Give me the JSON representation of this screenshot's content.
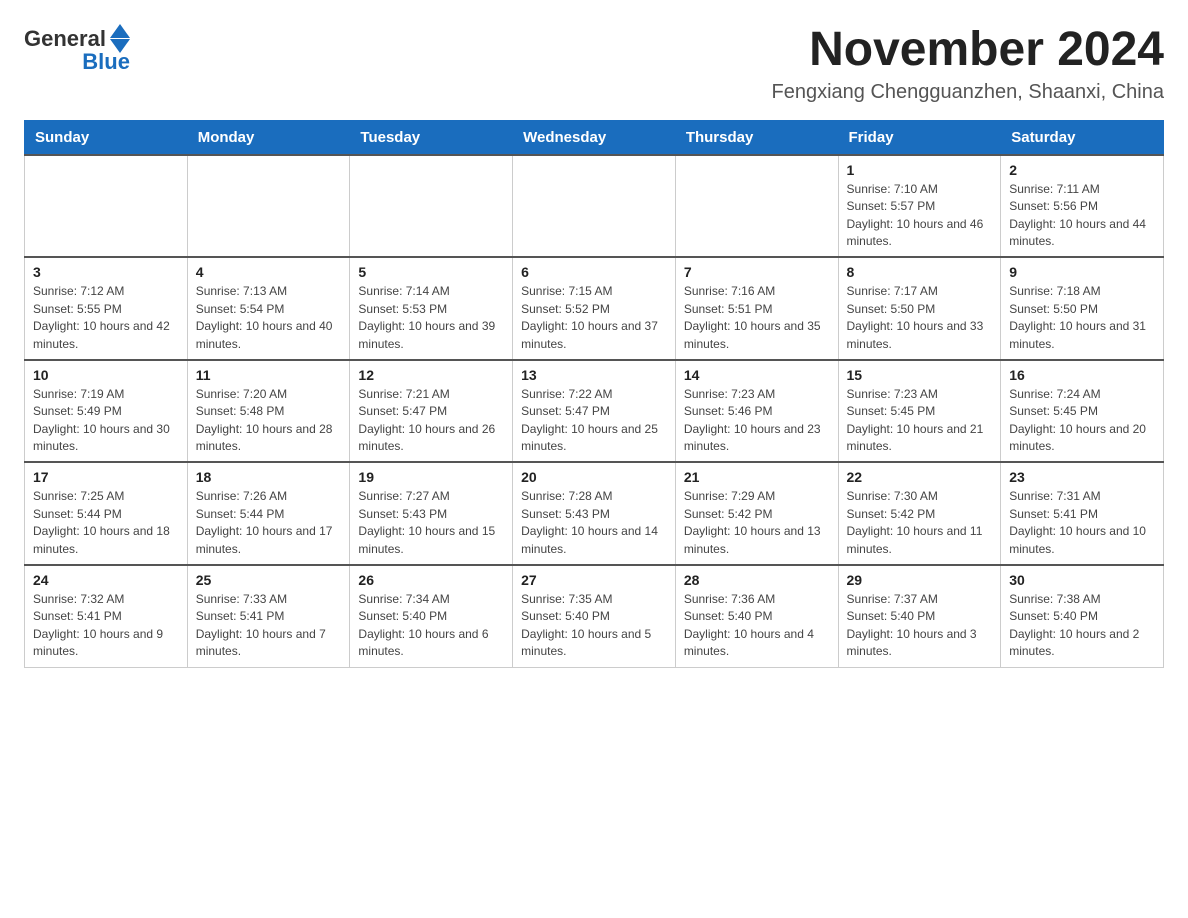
{
  "header": {
    "logo_general": "General",
    "logo_blue": "Blue",
    "title": "November 2024",
    "location": "Fengxiang Chengguanzhen, Shaanxi, China"
  },
  "days_of_week": [
    "Sunday",
    "Monday",
    "Tuesday",
    "Wednesday",
    "Thursday",
    "Friday",
    "Saturday"
  ],
  "weeks": [
    [
      {
        "day": "",
        "info": ""
      },
      {
        "day": "",
        "info": ""
      },
      {
        "day": "",
        "info": ""
      },
      {
        "day": "",
        "info": ""
      },
      {
        "day": "",
        "info": ""
      },
      {
        "day": "1",
        "info": "Sunrise: 7:10 AM\nSunset: 5:57 PM\nDaylight: 10 hours and 46 minutes."
      },
      {
        "day": "2",
        "info": "Sunrise: 7:11 AM\nSunset: 5:56 PM\nDaylight: 10 hours and 44 minutes."
      }
    ],
    [
      {
        "day": "3",
        "info": "Sunrise: 7:12 AM\nSunset: 5:55 PM\nDaylight: 10 hours and 42 minutes."
      },
      {
        "day": "4",
        "info": "Sunrise: 7:13 AM\nSunset: 5:54 PM\nDaylight: 10 hours and 40 minutes."
      },
      {
        "day": "5",
        "info": "Sunrise: 7:14 AM\nSunset: 5:53 PM\nDaylight: 10 hours and 39 minutes."
      },
      {
        "day": "6",
        "info": "Sunrise: 7:15 AM\nSunset: 5:52 PM\nDaylight: 10 hours and 37 minutes."
      },
      {
        "day": "7",
        "info": "Sunrise: 7:16 AM\nSunset: 5:51 PM\nDaylight: 10 hours and 35 minutes."
      },
      {
        "day": "8",
        "info": "Sunrise: 7:17 AM\nSunset: 5:50 PM\nDaylight: 10 hours and 33 minutes."
      },
      {
        "day": "9",
        "info": "Sunrise: 7:18 AM\nSunset: 5:50 PM\nDaylight: 10 hours and 31 minutes."
      }
    ],
    [
      {
        "day": "10",
        "info": "Sunrise: 7:19 AM\nSunset: 5:49 PM\nDaylight: 10 hours and 30 minutes."
      },
      {
        "day": "11",
        "info": "Sunrise: 7:20 AM\nSunset: 5:48 PM\nDaylight: 10 hours and 28 minutes."
      },
      {
        "day": "12",
        "info": "Sunrise: 7:21 AM\nSunset: 5:47 PM\nDaylight: 10 hours and 26 minutes."
      },
      {
        "day": "13",
        "info": "Sunrise: 7:22 AM\nSunset: 5:47 PM\nDaylight: 10 hours and 25 minutes."
      },
      {
        "day": "14",
        "info": "Sunrise: 7:23 AM\nSunset: 5:46 PM\nDaylight: 10 hours and 23 minutes."
      },
      {
        "day": "15",
        "info": "Sunrise: 7:23 AM\nSunset: 5:45 PM\nDaylight: 10 hours and 21 minutes."
      },
      {
        "day": "16",
        "info": "Sunrise: 7:24 AM\nSunset: 5:45 PM\nDaylight: 10 hours and 20 minutes."
      }
    ],
    [
      {
        "day": "17",
        "info": "Sunrise: 7:25 AM\nSunset: 5:44 PM\nDaylight: 10 hours and 18 minutes."
      },
      {
        "day": "18",
        "info": "Sunrise: 7:26 AM\nSunset: 5:44 PM\nDaylight: 10 hours and 17 minutes."
      },
      {
        "day": "19",
        "info": "Sunrise: 7:27 AM\nSunset: 5:43 PM\nDaylight: 10 hours and 15 minutes."
      },
      {
        "day": "20",
        "info": "Sunrise: 7:28 AM\nSunset: 5:43 PM\nDaylight: 10 hours and 14 minutes."
      },
      {
        "day": "21",
        "info": "Sunrise: 7:29 AM\nSunset: 5:42 PM\nDaylight: 10 hours and 13 minutes."
      },
      {
        "day": "22",
        "info": "Sunrise: 7:30 AM\nSunset: 5:42 PM\nDaylight: 10 hours and 11 minutes."
      },
      {
        "day": "23",
        "info": "Sunrise: 7:31 AM\nSunset: 5:41 PM\nDaylight: 10 hours and 10 minutes."
      }
    ],
    [
      {
        "day": "24",
        "info": "Sunrise: 7:32 AM\nSunset: 5:41 PM\nDaylight: 10 hours and 9 minutes."
      },
      {
        "day": "25",
        "info": "Sunrise: 7:33 AM\nSunset: 5:41 PM\nDaylight: 10 hours and 7 minutes."
      },
      {
        "day": "26",
        "info": "Sunrise: 7:34 AM\nSunset: 5:40 PM\nDaylight: 10 hours and 6 minutes."
      },
      {
        "day": "27",
        "info": "Sunrise: 7:35 AM\nSunset: 5:40 PM\nDaylight: 10 hours and 5 minutes."
      },
      {
        "day": "28",
        "info": "Sunrise: 7:36 AM\nSunset: 5:40 PM\nDaylight: 10 hours and 4 minutes."
      },
      {
        "day": "29",
        "info": "Sunrise: 7:37 AM\nSunset: 5:40 PM\nDaylight: 10 hours and 3 minutes."
      },
      {
        "day": "30",
        "info": "Sunrise: 7:38 AM\nSunset: 5:40 PM\nDaylight: 10 hours and 2 minutes."
      }
    ]
  ]
}
